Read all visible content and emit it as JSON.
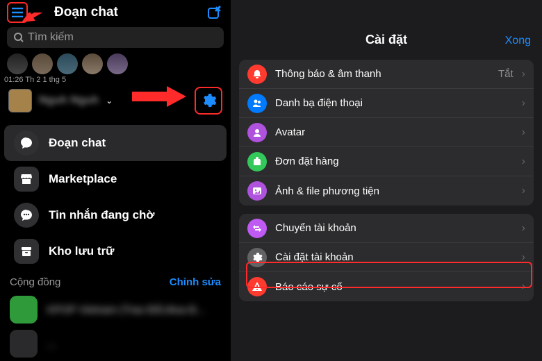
{
  "left": {
    "header_title": "Đoạn chat",
    "search_placeholder": "Tìm kiếm",
    "timestamp": "01:26  Th 2 1 thg 5",
    "profile_name": "Nguh Nguh",
    "menu": [
      {
        "label": "Đoạn chat",
        "active": true
      },
      {
        "label": "Marketplace"
      },
      {
        "label": "Tin nhắn đang chờ"
      },
      {
        "label": "Kho lưu trữ"
      }
    ],
    "community_header": "Cộng đồng",
    "edit_label": "Chỉnh sửa",
    "community_items": [
      "KPOP Vietnam (Trao Đổi,Mua B...",
      "..."
    ]
  },
  "right": {
    "title": "Cài đặt",
    "done": "Xong",
    "group1": [
      {
        "icon": "bell",
        "color": "c-red",
        "label": "Thông báo & âm thanh",
        "value": "Tắt"
      },
      {
        "icon": "contacts",
        "color": "c-blu",
        "label": "Danh bạ điện thoại"
      },
      {
        "icon": "avatar",
        "color": "c-mag",
        "label": "Avatar"
      },
      {
        "icon": "orders",
        "color": "c-grn",
        "label": "Đơn đặt hàng"
      },
      {
        "icon": "media",
        "color": "c-pur",
        "label": "Ảnh & file phương tiện"
      }
    ],
    "group2": [
      {
        "icon": "switch",
        "color": "c-mg2",
        "label": "Chuyển tài khoản"
      },
      {
        "icon": "settings",
        "color": "c-gry",
        "label": "Cài đặt tài khoản"
      },
      {
        "icon": "report",
        "color": "c-red",
        "label": "Báo cáo sự cố"
      }
    ]
  }
}
